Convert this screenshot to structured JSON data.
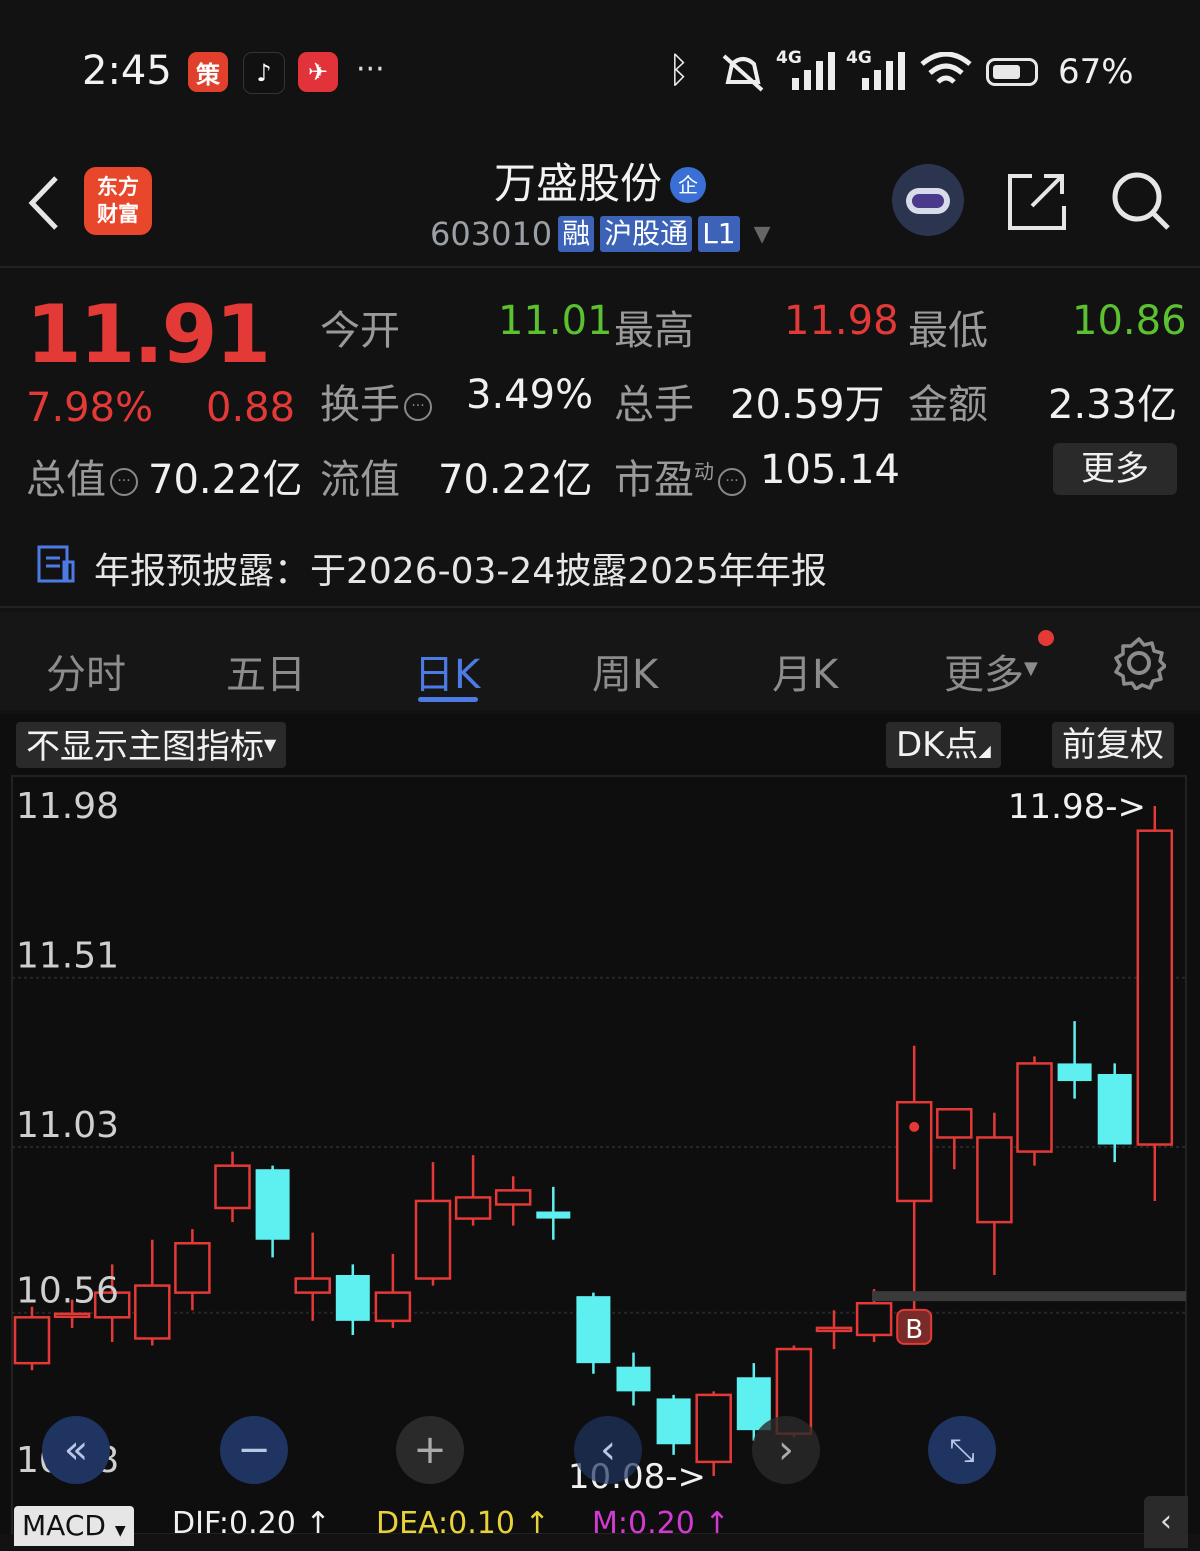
{
  "status_bar": {
    "time": "2:45",
    "more": "···",
    "net1": "4G",
    "net2": "4G",
    "battery_pct": "67%",
    "battery_level": 0.67
  },
  "header": {
    "logo_line1": "东方",
    "logo_line2": "财富",
    "stock_name": "万盛股份",
    "company_badge": "企",
    "code": "603010",
    "tags": [
      "融",
      "沪股通",
      "L1"
    ]
  },
  "quote": {
    "price": "11.91",
    "change_pct": "7.98%",
    "change": "0.88",
    "fields": [
      {
        "label": "今开",
        "value": "11.01"
      },
      {
        "label": "最高",
        "value": "11.98"
      },
      {
        "label": "最低",
        "value": "10.86"
      },
      {
        "label": "换手",
        "value": "3.49%"
      },
      {
        "label": "总手",
        "value": "20.59万"
      },
      {
        "label": "金额",
        "value": "2.33亿"
      },
      {
        "label": "总值",
        "value": "70.22亿"
      },
      {
        "label": "流值",
        "value": "70.22亿"
      },
      {
        "label": "市盈",
        "sup": "动",
        "value": "105.14"
      }
    ],
    "more": "更多"
  },
  "notice": "年报预披露：于2026-03-24披露2025年年报",
  "tabs": [
    "分时",
    "五日",
    "日K",
    "周K",
    "月K",
    "更多"
  ],
  "active_tab": "日K",
  "toolbar": {
    "indicator": "不显示主图指标",
    "dk": "DK点",
    "adjust": "前复权"
  },
  "chart_data": {
    "type": "candlestick",
    "y_ticks": [
      "11.98",
      "11.51",
      "11.03",
      "10.56",
      "10.08"
    ],
    "ylim": [
      10.08,
      11.98
    ],
    "max_label": "11.98->",
    "min_label": "10.08->",
    "buy_marker": "B",
    "candles": [
      {
        "o": 10.4,
        "c": 10.53,
        "h": 10.56,
        "l": 10.38
      },
      {
        "o": 10.54,
        "c": 10.54,
        "h": 10.58,
        "l": 10.5
      },
      {
        "o": 10.53,
        "c": 10.6,
        "h": 10.68,
        "l": 10.46
      },
      {
        "o": 10.47,
        "c": 10.62,
        "h": 10.75,
        "l": 10.45
      },
      {
        "o": 10.6,
        "c": 10.74,
        "h": 10.78,
        "l": 10.55
      },
      {
        "o": 10.84,
        "c": 10.96,
        "h": 11.0,
        "l": 10.8
      },
      {
        "o": 10.95,
        "c": 10.75,
        "h": 10.96,
        "l": 10.7
      },
      {
        "o": 10.6,
        "c": 10.64,
        "h": 10.77,
        "l": 10.52
      },
      {
        "o": 10.65,
        "c": 10.52,
        "h": 10.68,
        "l": 10.48
      },
      {
        "o": 10.52,
        "c": 10.6,
        "h": 10.71,
        "l": 10.5
      },
      {
        "o": 10.64,
        "c": 10.86,
        "h": 10.97,
        "l": 10.62
      },
      {
        "o": 10.81,
        "c": 10.87,
        "h": 10.99,
        "l": 10.79
      },
      {
        "o": 10.85,
        "c": 10.89,
        "h": 10.93,
        "l": 10.79
      },
      {
        "o": 10.83,
        "c": 10.81,
        "h": 10.9,
        "l": 10.75
      },
      {
        "o": 10.59,
        "c": 10.4,
        "h": 10.6,
        "l": 10.37
      },
      {
        "o": 10.39,
        "c": 10.32,
        "h": 10.43,
        "l": 10.28
      },
      {
        "o": 10.3,
        "c": 10.17,
        "h": 10.31,
        "l": 10.14
      },
      {
        "o": 10.12,
        "c": 10.31,
        "h": 10.32,
        "l": 10.08
      },
      {
        "o": 10.36,
        "c": 10.21,
        "h": 10.4,
        "l": 10.18
      },
      {
        "o": 10.2,
        "c": 10.44,
        "h": 10.45,
        "l": 10.19
      },
      {
        "o": 10.5,
        "c": 10.5,
        "h": 10.55,
        "l": 10.44
      },
      {
        "o": 10.48,
        "c": 10.57,
        "h": 10.61,
        "l": 10.46
      },
      {
        "o": 10.86,
        "c": 11.14,
        "h": 11.3,
        "l": 10.53
      },
      {
        "o": 11.04,
        "c": 11.12,
        "h": 11.12,
        "l": 10.95
      },
      {
        "o": 10.8,
        "c": 11.04,
        "h": 11.11,
        "l": 10.65
      },
      {
        "o": 11.0,
        "c": 11.25,
        "h": 11.27,
        "l": 10.96
      },
      {
        "o": 11.25,
        "c": 11.2,
        "h": 11.37,
        "l": 11.15
      },
      {
        "o": 11.22,
        "c": 11.02,
        "h": 11.25,
        "l": 10.97
      },
      {
        "o": 11.02,
        "c": 11.91,
        "h": 11.98,
        "l": 10.86
      }
    ],
    "macd": {
      "name": "MACD",
      "dif": "DIF:0.20",
      "dea": "DEA:0.10",
      "m": "M:0.20"
    }
  },
  "colors": {
    "up": "#e43a37",
    "down": "#5ef0f0",
    "accent": "#4d7be6",
    "bg": "#121212"
  }
}
